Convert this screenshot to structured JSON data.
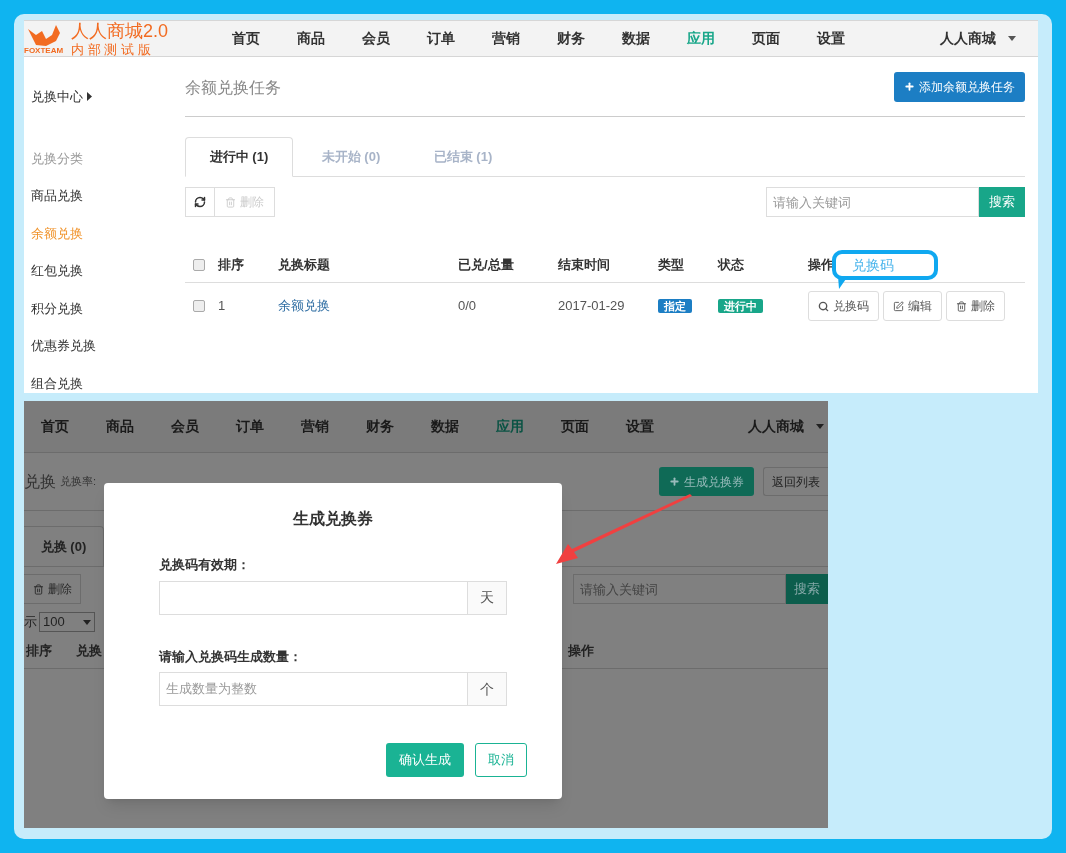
{
  "top": {
    "logo": {
      "title": "人人商城2.0",
      "subtitle": "内 部 测 试 版",
      "mark": "FOXTEAM"
    },
    "nav": [
      {
        "label": "首页",
        "selected": false
      },
      {
        "label": "商品",
        "selected": false
      },
      {
        "label": "会员",
        "selected": false
      },
      {
        "label": "订单",
        "selected": false
      },
      {
        "label": "营销",
        "selected": false
      },
      {
        "label": "财务",
        "selected": false
      },
      {
        "label": "数据",
        "selected": false
      },
      {
        "label": "应用",
        "selected": true
      },
      {
        "label": "页面",
        "selected": false
      },
      {
        "label": "设置",
        "selected": false
      }
    ],
    "account": "人人商城",
    "sidebar": {
      "heading": "兑换中心",
      "group": "兑换分类",
      "items": [
        {
          "label": "商品兑换",
          "selected": false
        },
        {
          "label": "余额兑换",
          "selected": true
        },
        {
          "label": "红包兑换",
          "selected": false
        },
        {
          "label": "积分兑换",
          "selected": false
        },
        {
          "label": "优惠券兑换",
          "selected": false
        },
        {
          "label": "组合兑换",
          "selected": false
        }
      ]
    },
    "page_title": "余额兑换任务",
    "add_button": "添加余额兑换任务",
    "tabs": [
      {
        "label": "进行中 (1)",
        "selected": true
      },
      {
        "label": "未开始 (0)",
        "selected": false
      },
      {
        "label": "已结束 (1)",
        "selected": false
      }
    ],
    "delete_button": {
      "label": "删除",
      "disabled": true
    },
    "search": {
      "placeholder": "请输入关键词",
      "button": "搜索"
    },
    "header_checked": false,
    "columns": [
      "排序",
      "兑换标题",
      "已兑/总量",
      "结束时间",
      "类型",
      "状态",
      "操作"
    ],
    "rows": [
      {
        "checked": false,
        "order": "1",
        "title": "余额兑换",
        "redeemed": "0/0",
        "end_time": "2017-01-29",
        "type": "指定",
        "status": "进行中",
        "actions": [
          {
            "label": "兑换码",
            "kind": "code"
          },
          {
            "label": "编辑",
            "kind": "edit"
          },
          {
            "label": "删除",
            "kind": "delete"
          }
        ]
      }
    ],
    "callout": "兑换码"
  },
  "bottom": {
    "nav": [
      {
        "label": "首页",
        "selected": false
      },
      {
        "label": "商品",
        "selected": false
      },
      {
        "label": "会员",
        "selected": false
      },
      {
        "label": "订单",
        "selected": false
      },
      {
        "label": "营销",
        "selected": false
      },
      {
        "label": "财务",
        "selected": false
      },
      {
        "label": "数据",
        "selected": false
      },
      {
        "label": "应用",
        "selected": true
      },
      {
        "label": "页面",
        "selected": false
      },
      {
        "label": "设置",
        "selected": false
      }
    ],
    "account": "人人商城",
    "title": "兑换",
    "subtitle": "兑换率:",
    "generate_button": "生成兑换券",
    "back_button": "返回列表",
    "tab": {
      "label": "兑换 (0)",
      "selected": true
    },
    "delete_button": "删除",
    "page_size_label": "示",
    "page_size": "100",
    "search": {
      "placeholder": "请输入关键词",
      "button": "搜索"
    },
    "columns": [
      "排序",
      "兑换",
      "操作"
    ],
    "modal": {
      "title": "生成兑换券",
      "fields": [
        {
          "label": "兑换码有效期：",
          "unit": "天"
        },
        {
          "label": "请输入兑换码生成数量：",
          "placeholder": "生成数量为整数",
          "unit": "个"
        }
      ],
      "confirm": "确认生成",
      "cancel": "取消"
    }
  }
}
